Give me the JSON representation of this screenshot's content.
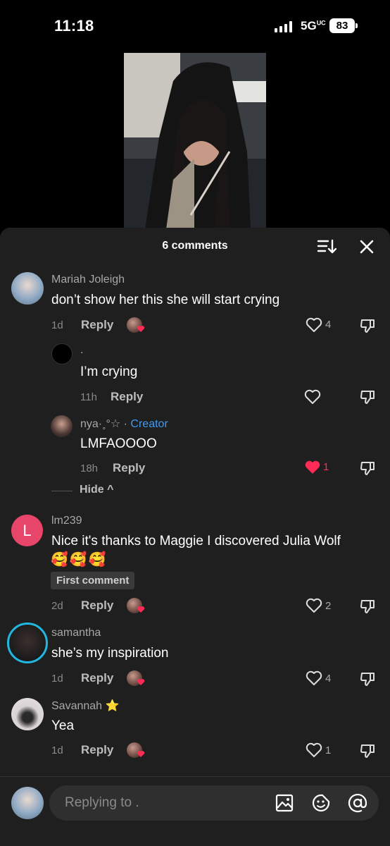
{
  "status": {
    "time": "11:18",
    "network": "5G",
    "network_sup": "UC",
    "battery": "83"
  },
  "sheet": {
    "title": "6 comments"
  },
  "comments": [
    {
      "username": "Mariah Joleigh",
      "text": "don’t show her this she will start crying",
      "time": "1d",
      "reply": "Reply",
      "likes": "4"
    },
    {
      "username": ".",
      "text": "I’m crying",
      "time": "11h",
      "reply": "Reply",
      "likes": ""
    },
    {
      "username": "nya·˳°☆ · ",
      "creator_label": "Creator",
      "text": "LMFAOOOO",
      "time": "18h",
      "reply": "Reply",
      "likes": "1"
    },
    {
      "username": "lm239",
      "text": "Nice it's thanks to Maggie I discovered Julia Wolf",
      "emojis": "🥰🥰🥰",
      "tag": "First comment",
      "time": "2d",
      "reply": "Reply",
      "likes": "2",
      "avatar_letter": "L"
    },
    {
      "username": "samantha",
      "text": "she’s my inspiration",
      "time": "1d",
      "reply": "Reply",
      "likes": "4"
    },
    {
      "username": "Savannah ⭐",
      "text": "Yea",
      "time": "1d",
      "reply": "Reply",
      "likes": "1"
    }
  ],
  "hide_label": "Hide ^",
  "input": {
    "placeholder": "Replying to ."
  },
  "colors": {
    "sheet_bg": "#1f1f1f",
    "liked_heart": "#fe2c55",
    "creator": "#3d9bf5",
    "avatar_l": "#e8456a"
  },
  "icons": [
    "sort-icon",
    "close-icon",
    "heart-icon",
    "dislike-icon",
    "image-icon",
    "sticker-icon",
    "mention-icon"
  ]
}
